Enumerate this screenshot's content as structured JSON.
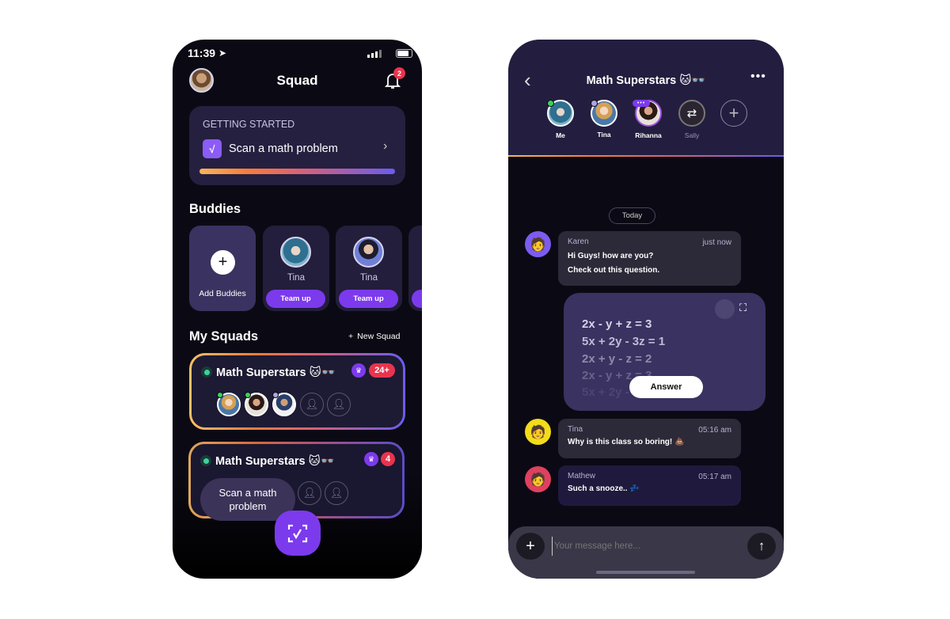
{
  "squad_screen": {
    "status": {
      "time": "11:39"
    },
    "title": "Squad",
    "notifications_count": "2",
    "getting_started": {
      "heading": "GETTING STARTED",
      "task": "Scan a math problem",
      "progress_percent": 100
    },
    "buddies": {
      "heading": "Buddies",
      "add_label": "Add Buddies",
      "items": [
        {
          "name": "Tina",
          "button": "Team up"
        },
        {
          "name": "Tina",
          "button": "Team up"
        }
      ]
    },
    "my_squads": {
      "heading": "My Squads",
      "new_squad": "New Squad",
      "items": [
        {
          "title": "Math Superstars 🐱👓",
          "count": "24+"
        },
        {
          "title": "Math Superstars 🐱👓",
          "count": "4"
        }
      ]
    },
    "tooltip": "Scan a math problem",
    "colors": {
      "accent": "#7c3aed",
      "badge": "#e8344e",
      "card": "#252040"
    }
  },
  "chat_screen": {
    "title": "Math Superstars 🐱👓",
    "members": [
      {
        "name": "Me"
      },
      {
        "name": "Tina"
      },
      {
        "name": "Rihanna"
      },
      {
        "name": "Sally"
      }
    ],
    "date_divider": "Today",
    "messages": [
      {
        "sender": "Karen",
        "time": "just now",
        "lines": [
          "Hi Guys! how are you?",
          "Check out this question."
        ]
      },
      {
        "sender": "Tina",
        "time": "05:16 am",
        "text": "Why is this class so boring! 💩"
      },
      {
        "sender": "Mathew",
        "time": "05:17 am",
        "text": "Such a snooze.. 💤"
      }
    ],
    "question": {
      "equations": [
        "2x - y + z = 3",
        "5x + 2y - 3z = 1",
        "2x + y - z = 2",
        "2x - y + z = 3",
        "5x + 2y - 3z = 1"
      ],
      "answer_button": "Answer"
    },
    "input": {
      "placeholder": "Your message here..."
    }
  }
}
